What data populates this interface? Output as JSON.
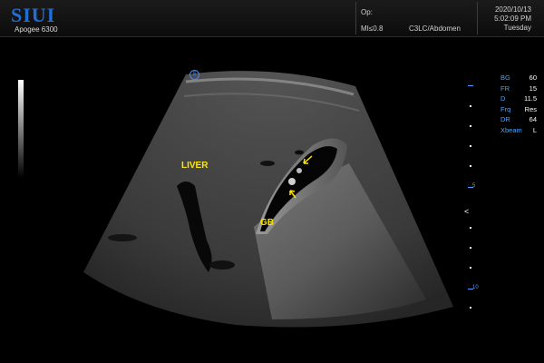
{
  "header": {
    "brand": "SIUI",
    "model": "Apogee 6300",
    "operator_label": "Op:",
    "mechanical_index": "MI≤0.8",
    "probe_preset": "C3LC/Abdomen",
    "date": "2020/10/13",
    "time": "5:02:09 PM",
    "weekday": "Tuesday"
  },
  "params": [
    {
      "key": "BG",
      "value": "60"
    },
    {
      "key": "FR",
      "value": "15"
    },
    {
      "key": "D",
      "value": "11.5"
    },
    {
      "key": "Frq",
      "value": "Res"
    },
    {
      "key": "DR",
      "value": "64"
    },
    {
      "key": "Xbeam",
      "value": "L"
    }
  ],
  "depth_scale": {
    "labels": [
      "5",
      "10"
    ]
  },
  "annotations": {
    "liver": "LIVER",
    "gallbladder": "GB"
  },
  "orientation_marker": "S",
  "focus_marker": "<",
  "colors": {
    "brand": "#1f6fd6",
    "param_key": "#49a6ff",
    "annotation": "#ffe500",
    "scale": "#4f9cff"
  }
}
